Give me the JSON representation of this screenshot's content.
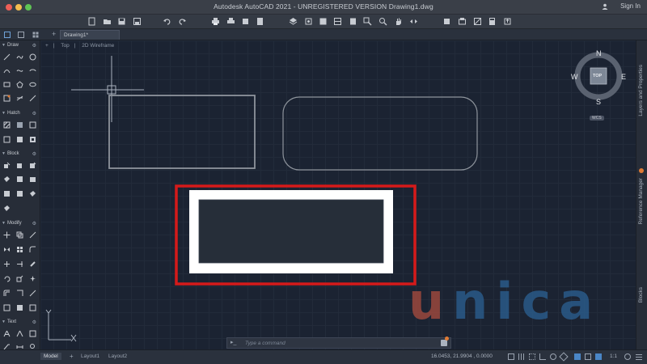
{
  "window": {
    "title": "Autodesk AutoCAD 2021 - UNREGISTERED VERSION   Drawing1.dwg",
    "sign_in": "Sign In"
  },
  "tabs": {
    "active": "Drawing1*"
  },
  "viewport": {
    "view": "Top",
    "style": "2D Wireframe"
  },
  "palette": {
    "sections": {
      "draw": "Draw",
      "hatch": "Hatch",
      "block": "Block",
      "modify": "Modify",
      "text": "Text"
    }
  },
  "viewcube": {
    "face": "TOP",
    "north": "N",
    "south": "S",
    "east": "E",
    "west": "W",
    "wcs": "WCS"
  },
  "right_panels": {
    "layers": "Layers and Properties",
    "reference": "Reference Manager",
    "blocks": "Blocks"
  },
  "command": {
    "placeholder": "Type a command"
  },
  "layouts": {
    "model": "Model",
    "layout1": "Layout1",
    "layout2": "Layout2"
  },
  "status": {
    "coords": "16.0453, 21.9904 , 0.0000",
    "scale": "1:1"
  },
  "ucs": {
    "x": "X",
    "y": "Y"
  },
  "watermark": {
    "u": "u",
    "rest": "nica"
  },
  "colors": {
    "highlight": "#d51a1a",
    "background": "#1b2332"
  }
}
